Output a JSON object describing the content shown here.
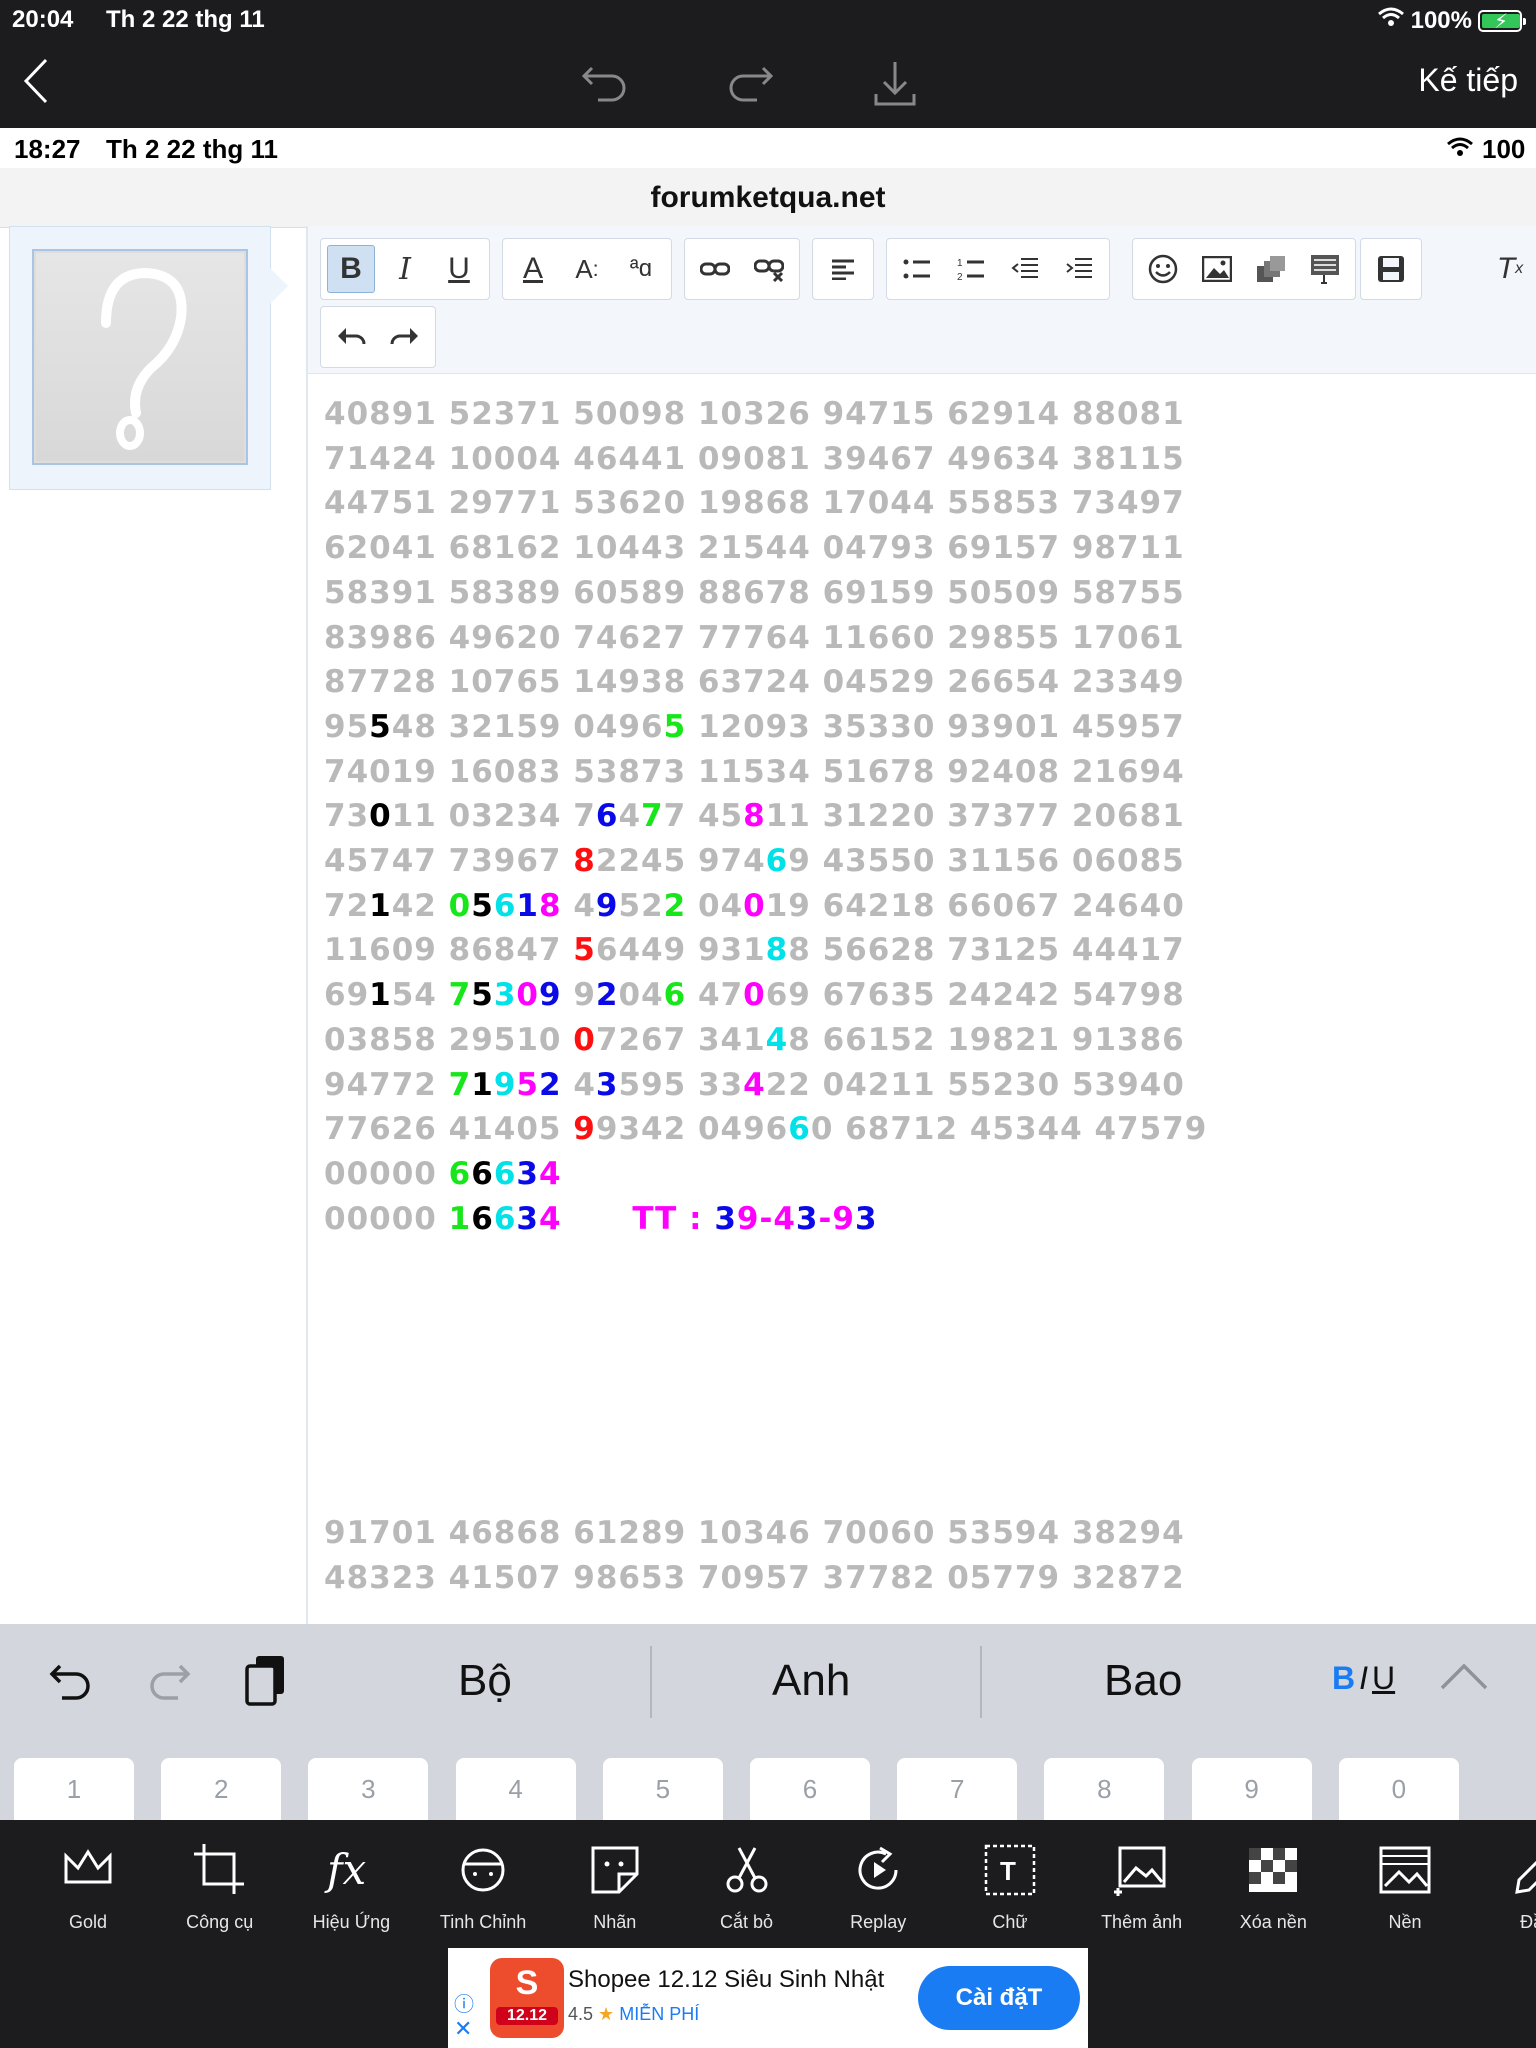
{
  "app_status": {
    "time": "20:04",
    "date": "Th 2 22 thg 11",
    "battery": "100%"
  },
  "app_nav": {
    "next_label": "Kế tiếp"
  },
  "screenshot": {
    "status": {
      "time": "18:27",
      "date": "Th 2 22 thg 11",
      "battery": "100"
    },
    "url": "forumketqua.net"
  },
  "number_lines": [
    [
      [
        "40891 52371 50098 10326 94715 62914 88081",
        ""
      ]
    ],
    [
      [
        "71424 10004 46441 09081 39467 49634 38115",
        ""
      ]
    ],
    [
      [
        "44751 29771 53620 19868 17044 55853 73497",
        ""
      ]
    ],
    [
      [
        "62041 68162 10443 21544 04793 69157 98711",
        ""
      ]
    ],
    [
      [
        "58391 58389 60589 88678 69159 50509 58755",
        ""
      ]
    ],
    [
      [
        "83986 49620 74627 77764 11660 29855 17061",
        ""
      ]
    ],
    [
      [
        "87728 10765 14938 63724 04529 26654 23349",
        ""
      ]
    ],
    [
      [
        "95",
        ""
      ],
      [
        "5",
        "k"
      ],
      [
        "48 32159 0496",
        ""
      ],
      [
        "5",
        "g"
      ],
      [
        " 12093 35330 93901 45957",
        ""
      ]
    ],
    [
      [
        "74019 16083 53873 11534 51678 92408 21694",
        ""
      ]
    ],
    [
      [
        "73",
        ""
      ],
      [
        "0",
        "k"
      ],
      [
        "11 03234 7",
        ""
      ],
      [
        "6",
        "b"
      ],
      [
        "4",
        ""
      ],
      [
        "7",
        "g"
      ],
      [
        "7 45",
        ""
      ],
      [
        "8",
        "m"
      ],
      [
        "11 31220 37377 20681",
        ""
      ]
    ],
    [
      [
        "45747 73967 ",
        ""
      ],
      [
        "8",
        "r"
      ],
      [
        "2245 974",
        ""
      ],
      [
        "6",
        "c"
      ],
      [
        "9 43550 31156 06085",
        ""
      ]
    ],
    [
      [
        "72",
        ""
      ],
      [
        "1",
        "k"
      ],
      [
        "42 ",
        ""
      ],
      [
        "0",
        "g"
      ],
      [
        "5",
        "k"
      ],
      [
        "6",
        "c"
      ],
      [
        "1",
        "b"
      ],
      [
        "8",
        "m"
      ],
      [
        " 4",
        ""
      ],
      [
        "9",
        "b"
      ],
      [
        "52",
        ""
      ],
      [
        "2",
        "g"
      ],
      [
        " 04",
        ""
      ],
      [
        "0",
        "m"
      ],
      [
        "19 64218 66067 24640",
        ""
      ]
    ],
    [
      [
        "11609 86847 ",
        ""
      ],
      [
        "5",
        "r"
      ],
      [
        "6449 931",
        ""
      ],
      [
        "8",
        "c"
      ],
      [
        "8 56628 73125 44417",
        ""
      ]
    ],
    [
      [
        "69",
        ""
      ],
      [
        "1",
        "k"
      ],
      [
        "54 ",
        ""
      ],
      [
        "7",
        "g"
      ],
      [
        "5",
        "k"
      ],
      [
        "3",
        "c"
      ],
      [
        "0",
        "m"
      ],
      [
        "9",
        "b"
      ],
      [
        " 9",
        ""
      ],
      [
        "2",
        "b"
      ],
      [
        "04",
        ""
      ],
      [
        "6",
        "g"
      ],
      [
        " 47",
        ""
      ],
      [
        "0",
        "m"
      ],
      [
        "69 67635 24242 54798",
        ""
      ]
    ],
    [
      [
        "03858 29510 ",
        ""
      ],
      [
        "0",
        "r"
      ],
      [
        "7267 341",
        ""
      ],
      [
        "4",
        "c"
      ],
      [
        "8 66152 19821 91386",
        ""
      ]
    ],
    [
      [
        "94772 ",
        ""
      ],
      [
        "7",
        "g"
      ],
      [
        "1",
        "k"
      ],
      [
        "9",
        "c"
      ],
      [
        "5",
        "m"
      ],
      [
        "2",
        "b"
      ],
      [
        " 4",
        ""
      ],
      [
        "3",
        "b"
      ],
      [
        "595 33",
        ""
      ],
      [
        "4",
        "m"
      ],
      [
        "22 04211 55230 53940",
        ""
      ]
    ],
    [
      [
        "77626 41405 ",
        ""
      ],
      [
        "9",
        "r"
      ],
      [
        "9342 0496",
        ""
      ],
      [
        "6",
        "c"
      ],
      [
        "0 68712 45344 47579",
        ""
      ]
    ],
    [
      [
        "00000 ",
        ""
      ],
      [
        "6",
        "g"
      ],
      [
        "6",
        "k"
      ],
      [
        "6",
        "c"
      ],
      [
        "3",
        "b"
      ],
      [
        "4",
        "m"
      ]
    ],
    [
      [
        "00000 ",
        ""
      ],
      [
        "1",
        "g"
      ],
      [
        "6",
        "k"
      ],
      [
        "6",
        "c"
      ],
      [
        "3",
        "b"
      ],
      [
        "4",
        "m"
      ],
      [
        "      ",
        ""
      ],
      [
        "TT : ",
        "m"
      ],
      [
        "3",
        "b"
      ],
      [
        "9",
        "m"
      ],
      [
        "-",
        "m"
      ],
      [
        "4",
        "m"
      ],
      [
        "3",
        "b"
      ],
      [
        "-",
        "m"
      ],
      [
        "9",
        "m"
      ],
      [
        "3",
        "b"
      ]
    ]
  ],
  "lower_lines": [
    "91701 46868 61289 10346 70060 53594 38294",
    "48323 41507 98653 70957 37782 05779 32872"
  ],
  "keyboard": {
    "suggestions": [
      "Bộ",
      "Anh",
      "Bao"
    ],
    "format_b": "B",
    "format_i": "I",
    "format_u": "U",
    "number_keys": [
      "1",
      "2",
      "3",
      "4",
      "5",
      "6",
      "7",
      "8",
      "9",
      "0"
    ]
  },
  "tools": [
    {
      "label": "Gold",
      "icon": "crown-icon"
    },
    {
      "label": "Công cụ",
      "icon": "crop-icon"
    },
    {
      "label": "Hiệu Ứng",
      "icon": "fx-icon"
    },
    {
      "label": "Tinh Chỉnh",
      "icon": "retouch-face-icon"
    },
    {
      "label": "Nhãn",
      "icon": "sticker-icon"
    },
    {
      "label": "Cắt bỏ",
      "icon": "scissors-icon"
    },
    {
      "label": "Replay",
      "icon": "replay-icon"
    },
    {
      "label": "Chữ",
      "icon": "text-icon"
    },
    {
      "label": "Thêm ảnh",
      "icon": "add-photo-icon"
    },
    {
      "label": "Xóa nền",
      "icon": "remove-bg-icon"
    },
    {
      "label": "Nền",
      "icon": "background-icon"
    },
    {
      "label": "Đầu",
      "icon": "brush-icon"
    }
  ],
  "ad": {
    "title": "Shopee 12.12 Siêu Sinh Nhật",
    "rating": "4.5",
    "price": "MIỄN PHÍ",
    "install": "Cài đặT",
    "logo_text": "12.12"
  }
}
